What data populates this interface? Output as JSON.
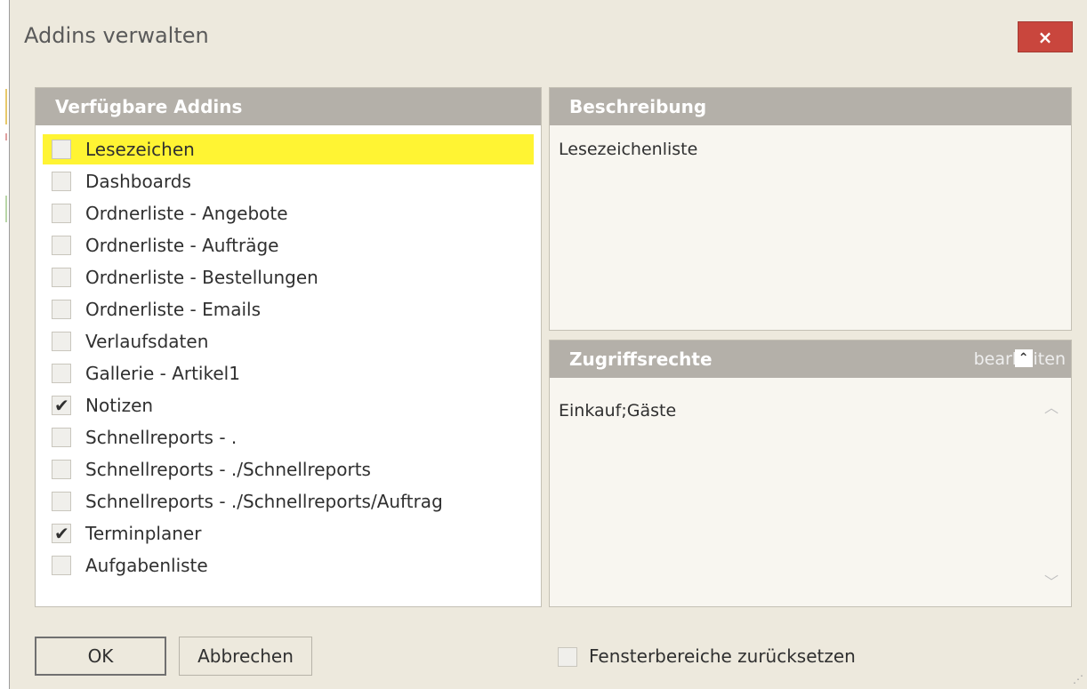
{
  "window": {
    "title": "Addins verwalten",
    "close_glyph": "×"
  },
  "addins_panel": {
    "header": "Verfügbare Addins",
    "items": [
      {
        "label": "Lesezeichen",
        "checked": false,
        "selected": true
      },
      {
        "label": "Dashboards",
        "checked": false
      },
      {
        "label": "Ordnerliste - Angebote",
        "checked": false
      },
      {
        "label": "Ordnerliste - Aufträge",
        "checked": false
      },
      {
        "label": "Ordnerliste - Bestellungen",
        "checked": false
      },
      {
        "label": "Ordnerliste - Emails",
        "checked": false
      },
      {
        "label": "Verlaufsdaten",
        "checked": false
      },
      {
        "label": "Gallerie - Artikel1",
        "checked": false
      },
      {
        "label": "Notizen",
        "checked": true
      },
      {
        "label": "Schnellreports - .",
        "checked": false
      },
      {
        "label": "Schnellreports - ./Schnellreports",
        "checked": false
      },
      {
        "label": "Schnellreports - ./Schnellreports/Auftrag",
        "checked": false
      },
      {
        "label": "Terminplaner",
        "checked": true
      },
      {
        "label": "Aufgabenliste",
        "checked": false
      }
    ]
  },
  "description_panel": {
    "header": "Beschreibung",
    "text": "Lesezeichenliste"
  },
  "access_panel": {
    "header": "Zugriffsrechte",
    "edit_link": "bearbeiten",
    "text": "Einkauf;Gäste"
  },
  "buttons": {
    "ok": "OK",
    "cancel": "Abbrechen"
  },
  "reset": {
    "label": "Fensterbereiche zurücksetzen",
    "checked": false
  },
  "icons": {
    "checkmark": "check-icon",
    "caret_up": "caret-up-icon",
    "scroll_up": "scroll-up-icon",
    "scroll_down": "scroll-down-icon"
  },
  "colors": {
    "selected_row": "#fff433",
    "panel_header": "#b4b0a9",
    "close_button": "#c9463d",
    "dialog_bg": "#ede9dd"
  }
}
